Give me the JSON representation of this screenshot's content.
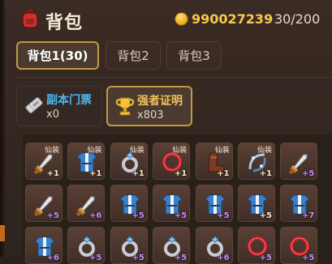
{
  "header": {
    "title": "背包",
    "coins": "990027239",
    "capacity": "30/200"
  },
  "tabs": [
    {
      "label": "背包1(30)",
      "active": true
    },
    {
      "label": "背包2",
      "active": false
    },
    {
      "label": "背包3",
      "active": false
    }
  ],
  "categories": [
    {
      "name": "副本门票",
      "count": "x0",
      "icon": "ticket-icon",
      "selected": false
    },
    {
      "name": "强者证明",
      "count": "x803",
      "icon": "trophy-icon",
      "selected": true
    }
  ],
  "slot_tag": "仙装",
  "inventory": [
    {
      "icon": "sword-icon",
      "level": "+1",
      "tag": true,
      "purple": false
    },
    {
      "icon": "armor-icon",
      "level": "+1",
      "tag": true,
      "purple": false
    },
    {
      "icon": "ring-icon",
      "level": "+1",
      "tag": true,
      "purple": false
    },
    {
      "icon": "necklace-icon",
      "level": "+1",
      "tag": true,
      "purple": false
    },
    {
      "icon": "boots-icon",
      "level": "+1",
      "tag": true,
      "purple": false
    },
    {
      "icon": "bracelet-icon",
      "level": "+1",
      "tag": true,
      "purple": false
    },
    {
      "icon": "sword-icon",
      "level": "+5",
      "tag": false,
      "purple": true
    },
    {
      "icon": "sword-icon",
      "level": "+5",
      "tag": false,
      "purple": true
    },
    {
      "icon": "sword-icon",
      "level": "+6",
      "tag": false,
      "purple": true
    },
    {
      "icon": "armor-icon",
      "level": "+5",
      "tag": false,
      "purple": true
    },
    {
      "icon": "armor-icon",
      "level": "+5",
      "tag": false,
      "purple": true
    },
    {
      "icon": "armor-icon",
      "level": "+5",
      "tag": false,
      "purple": true
    },
    {
      "icon": "armor-icon",
      "level": "+5",
      "tag": false,
      "purple": false
    },
    {
      "icon": "armor-icon",
      "level": "+7",
      "tag": false,
      "purple": true
    },
    {
      "icon": "armor-icon",
      "level": "+6",
      "tag": false,
      "purple": true
    },
    {
      "icon": "ring-icon",
      "level": "+5",
      "tag": false,
      "purple": true
    },
    {
      "icon": "ring-icon",
      "level": "+5",
      "tag": false,
      "purple": true
    },
    {
      "icon": "ring-icon",
      "level": "+5",
      "tag": false,
      "purple": true
    },
    {
      "icon": "ring-icon",
      "level": "+6",
      "tag": false,
      "purple": true
    },
    {
      "icon": "necklace-icon",
      "level": "+5",
      "tag": false,
      "purple": true
    },
    {
      "icon": "necklace-icon",
      "level": "+5",
      "tag": false,
      "purple": true
    }
  ],
  "colors": {
    "accent_gold": "#c49a45",
    "coin_text": "#f6c94b",
    "rarity_purple": "#c88cff",
    "ticket_blue": "#4fb6f0"
  }
}
